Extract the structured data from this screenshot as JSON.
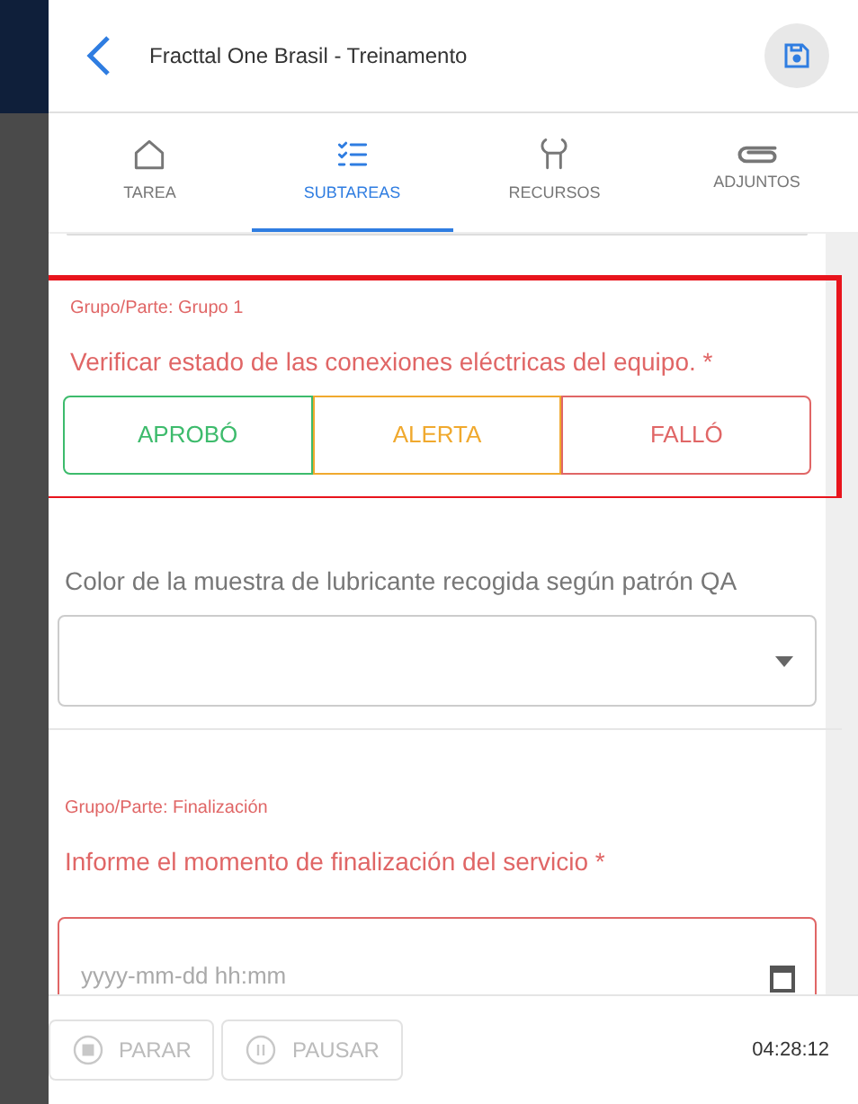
{
  "header": {
    "title": "Fracttal One Brasil - Treinamento"
  },
  "tabs": [
    {
      "label": "TAREA",
      "selected": false
    },
    {
      "label": "SUBTAREAS",
      "selected": true
    },
    {
      "label": "RECURSOS",
      "selected": false
    },
    {
      "label": "ADJUNTOS",
      "selected": false
    }
  ],
  "items": [
    {
      "kind": "choice",
      "highlighted": true,
      "group": "Grupo/Parte: Grupo 1",
      "question": "Verificar estado de las conexiones eléctricas del equipo. *",
      "required_missing": true,
      "options": [
        {
          "label": "APROBÓ",
          "color": "#3dbb6c",
          "selected": false
        },
        {
          "label": "ALERTA",
          "color": "#f0a92e",
          "selected": false
        },
        {
          "label": "FALLÓ",
          "color": "#e06666",
          "selected": false
        }
      ]
    },
    {
      "kind": "select",
      "highlighted": false,
      "question": "Color de la muestra de lubricante recogida según patrón QA",
      "required_missing": false
    },
    {
      "kind": "datetime",
      "highlighted": false,
      "group": "Grupo/Parte: Finalización",
      "question": "Informe el momento de finalización del servicio *",
      "required_missing": true,
      "placeholder": "yyyy-mm-dd hh:mm"
    }
  ],
  "footer": {
    "buttons": [
      {
        "label": "PARAR",
        "disabled": true
      },
      {
        "label": "PAUSAR",
        "disabled": true
      }
    ],
    "timer": "04:28:12"
  }
}
